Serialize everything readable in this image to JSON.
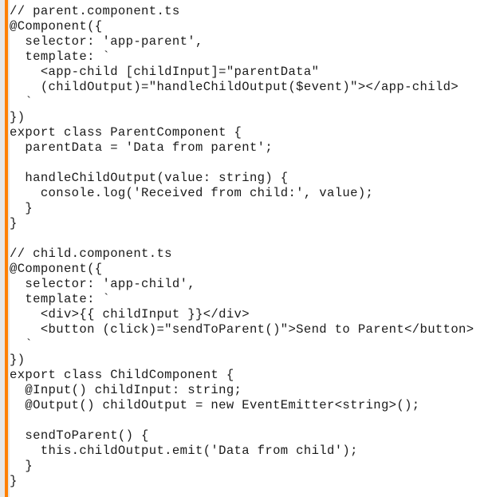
{
  "editor": {
    "accent_color": "#ff8000",
    "gutter_color": "#e6e6e6",
    "text_color": "#1a1a1a",
    "background_color": "#ffffff",
    "lines": [
      "// parent.component.ts",
      "@Component({",
      "  selector: 'app-parent',",
      "  template: `",
      "    <app-child [childInput]=\"parentData\"",
      "    (childOutput)=\"handleChildOutput($event)\"></app-child>",
      "  `",
      "})",
      "export class ParentComponent {",
      "  parentData = 'Data from parent';",
      "",
      "  handleChildOutput(value: string) {",
      "    console.log('Received from child:', value);",
      "  }",
      "}",
      "",
      "// child.component.ts",
      "@Component({",
      "  selector: 'app-child',",
      "  template: `",
      "    <div>{{ childInput }}</div>",
      "    <button (click)=\"sendToParent()\">Send to Parent</button>",
      "  `",
      "})",
      "export class ChildComponent {",
      "  @Input() childInput: string;",
      "  @Output() childOutput = new EventEmitter<string>();",
      "",
      "  sendToParent() {",
      "    this.childOutput.emit('Data from child');",
      "  }",
      "}"
    ]
  }
}
